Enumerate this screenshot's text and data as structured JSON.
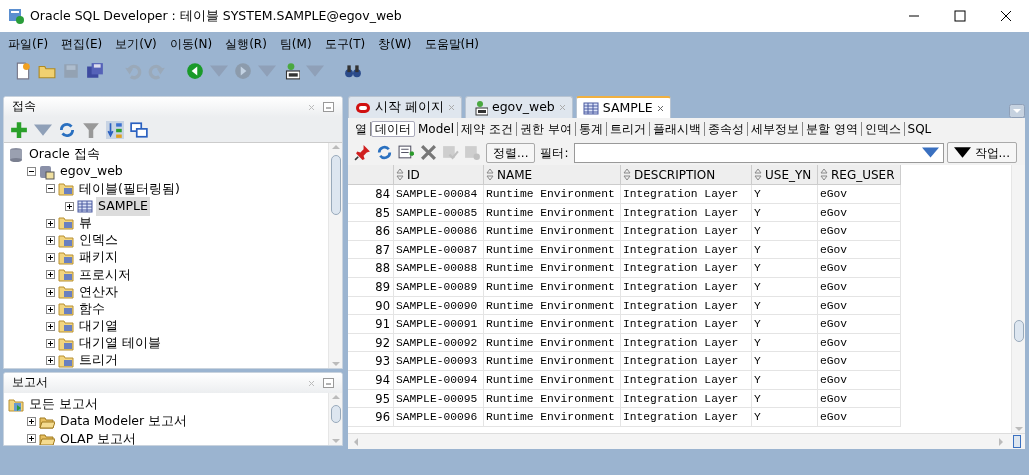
{
  "window": {
    "title": "Oracle SQL Developer : 테이블 SYSTEM.SAMPLE@egov_web"
  },
  "menu": [
    "파일(F)",
    "편집(E)",
    "보기(V)",
    "이동(N)",
    "실행(R)",
    "팀(M)",
    "도구(T)",
    "창(W)",
    "도움말(H)"
  ],
  "toolbar": [
    {
      "kind": "new",
      "disabled": false
    },
    {
      "kind": "open",
      "disabled": false
    },
    {
      "kind": "save",
      "disabled": true
    },
    {
      "kind": "save-all",
      "disabled": false
    },
    {
      "kind": "undo",
      "disabled": true
    },
    {
      "kind": "redo",
      "disabled": true
    },
    {
      "kind": "back",
      "disabled": false
    },
    {
      "kind": "forward",
      "disabled": true
    },
    {
      "kind": "sql",
      "disabled": false
    },
    {
      "kind": "find",
      "disabled": false
    }
  ],
  "connections_panel": {
    "title": "접속",
    "tree": [
      {
        "label": "Oracle 접속",
        "kind": "db",
        "children": [
          {
            "label": "egov_web",
            "kind": "conn",
            "expanded": true,
            "selected": false,
            "children": [
              {
                "label": "테이블(필터링됨)",
                "kind": "folder",
                "expanded": true,
                "selected": false,
                "children": [
                  {
                    "label": "SAMPLE",
                    "kind": "table",
                    "expanded": false,
                    "selected": true
                  }
                ]
              },
              {
                "label": "뷰",
                "kind": "folder",
                "expanded": false,
                "selected": false
              },
              {
                "label": "인덱스",
                "kind": "folder",
                "expanded": false,
                "selected": false
              },
              {
                "label": "패키지",
                "kind": "folder",
                "expanded": false,
                "selected": false
              },
              {
                "label": "프로시저",
                "kind": "folder",
                "expanded": false,
                "selected": false
              },
              {
                "label": "연산자",
                "kind": "folder",
                "expanded": false,
                "selected": false
              },
              {
                "label": "함수",
                "kind": "folder",
                "expanded": false,
                "selected": false
              },
              {
                "label": "대기열",
                "kind": "folder",
                "expanded": false,
                "selected": false
              },
              {
                "label": "대기열 테이블",
                "kind": "folder",
                "expanded": false,
                "selected": false
              },
              {
                "label": "트리거",
                "kind": "folder",
                "expanded": false,
                "selected": false
              }
            ]
          }
        ]
      }
    ]
  },
  "reports_panel": {
    "title": "보고서",
    "tree": [
      {
        "label": "모든 보고서",
        "kind": "reports",
        "children": [
          {
            "label": "Data Modeler 보고서",
            "kind": "open-folder",
            "expanded": false,
            "selected": false
          },
          {
            "label": "OLAP 보고서",
            "kind": "open-folder",
            "expanded": false,
            "selected": false
          }
        ]
      }
    ]
  },
  "editor_tabs": [
    {
      "label": "시작 페이지",
      "kind": "oracle",
      "selected": false
    },
    {
      "label": "egov_web",
      "kind": "sql",
      "selected": false
    },
    {
      "label": "SAMPLE",
      "kind": "table",
      "selected": true
    }
  ],
  "sub_tabs": [
    {
      "label": "열",
      "selected": false
    },
    {
      "label": "데이터",
      "selected": true
    },
    {
      "label": "Model",
      "selected": false
    },
    {
      "label": "제약 조건",
      "selected": false
    },
    {
      "label": "권한 부여",
      "selected": false
    },
    {
      "label": "통계",
      "selected": false
    },
    {
      "label": "트리거",
      "selected": false
    },
    {
      "label": "플래시백",
      "selected": false
    },
    {
      "label": "종속성",
      "selected": false
    },
    {
      "label": "세부정보",
      "selected": false
    },
    {
      "label": "분할 영역",
      "selected": false
    },
    {
      "label": "인덱스",
      "selected": false
    },
    {
      "label": "SQL",
      "selected": false
    }
  ],
  "data_toolbar": {
    "sort_button": "정렬...",
    "filter_label": "필터:",
    "actions_button": "작업..."
  },
  "table": {
    "columns": [
      "ID",
      "NAME",
      "DESCRIPTION",
      "USE_YN",
      "REG_USER"
    ],
    "rows": [
      {
        "num": "84",
        "cells": [
          "SAMPLE-00084",
          "Runtime Environment",
          "Integration Layer",
          "Y",
          "eGov"
        ]
      },
      {
        "num": "85",
        "cells": [
          "SAMPLE-00085",
          "Runtime Environment",
          "Integration Layer",
          "Y",
          "eGov"
        ]
      },
      {
        "num": "86",
        "cells": [
          "SAMPLE-00086",
          "Runtime Environment",
          "Integration Layer",
          "Y",
          "eGov"
        ]
      },
      {
        "num": "87",
        "cells": [
          "SAMPLE-00087",
          "Runtime Environment",
          "Integration Layer",
          "Y",
          "eGov"
        ]
      },
      {
        "num": "88",
        "cells": [
          "SAMPLE-00088",
          "Runtime Environment",
          "Integration Layer",
          "Y",
          "eGov"
        ]
      },
      {
        "num": "89",
        "cells": [
          "SAMPLE-00089",
          "Runtime Environment",
          "Integration Layer",
          "Y",
          "eGov"
        ]
      },
      {
        "num": "90",
        "cells": [
          "SAMPLE-00090",
          "Runtime Environment",
          "Integration Layer",
          "Y",
          "eGov"
        ]
      },
      {
        "num": "91",
        "cells": [
          "SAMPLE-00091",
          "Runtime Environment",
          "Integration Layer",
          "Y",
          "eGov"
        ]
      },
      {
        "num": "92",
        "cells": [
          "SAMPLE-00092",
          "Runtime Environment",
          "Integration Layer",
          "Y",
          "eGov"
        ]
      },
      {
        "num": "93",
        "cells": [
          "SAMPLE-00093",
          "Runtime Environment",
          "Integration Layer",
          "Y",
          "eGov"
        ]
      },
      {
        "num": "94",
        "cells": [
          "SAMPLE-00094",
          "Runtime Environment",
          "Integration Layer",
          "Y",
          "eGov"
        ]
      },
      {
        "num": "95",
        "cells": [
          "SAMPLE-00095",
          "Runtime Environment",
          "Integration Layer",
          "Y",
          "eGov"
        ]
      },
      {
        "num": "96",
        "cells": [
          "SAMPLE-00096",
          "Runtime Environment",
          "Integration Layer",
          "Y",
          "eGov"
        ]
      }
    ]
  }
}
